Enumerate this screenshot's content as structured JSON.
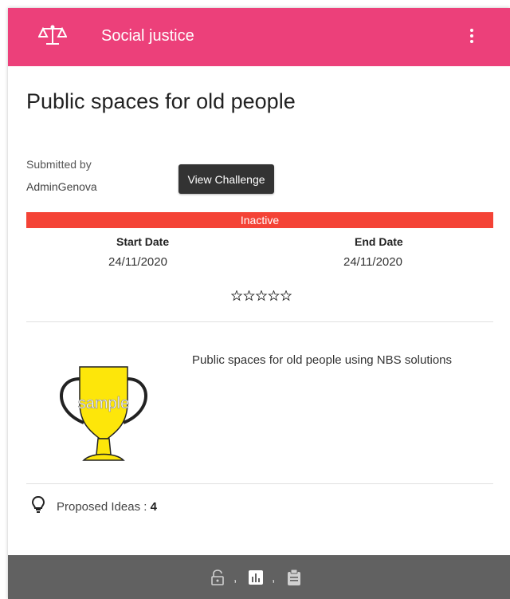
{
  "header": {
    "category": "Social justice",
    "category_icon": "scales-icon",
    "menu_icon": "more-vert-icon",
    "color": "#ec407a"
  },
  "challenge": {
    "title": "Public spaces for old people",
    "submitted_by_label": "Submitted by",
    "submitted_by": "AdminGenova",
    "view_button": "View Challenge",
    "status": "Inactive",
    "status_color": "#f44336",
    "start_date_label": "Start Date",
    "start_date": "24/11/2020",
    "end_date_label": "End Date",
    "end_date": "24/11/2020",
    "rating": 0,
    "rating_max": 5,
    "image_caption": "sample",
    "description": "Public spaces for old people using NBS solutions",
    "ideas_label": "Proposed Ideas : ",
    "ideas_count": "4"
  },
  "footer": {
    "steps": [
      {
        "icon": "lock-open-icon"
      },
      {
        "icon": "bar-chart-icon"
      },
      {
        "icon": "clipboard-icon"
      }
    ],
    "separator": ","
  }
}
